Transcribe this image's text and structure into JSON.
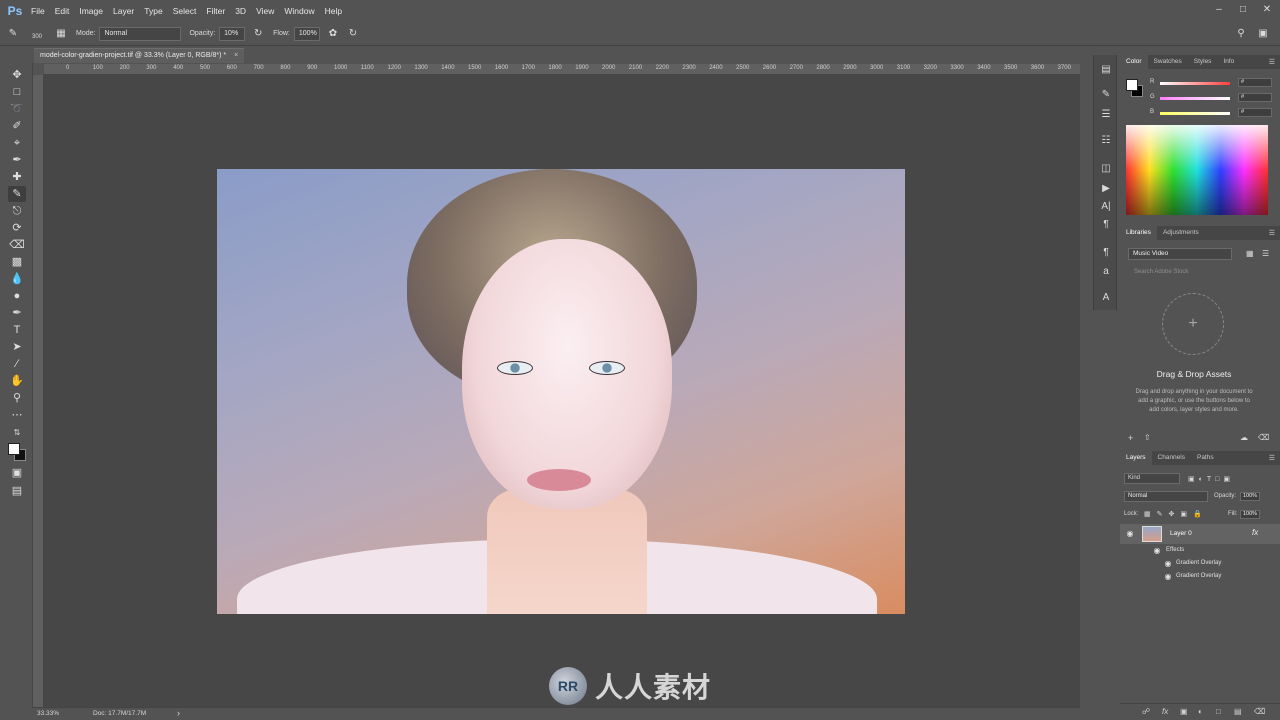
{
  "app": {
    "logo": "Ps"
  },
  "menu": [
    "File",
    "Edit",
    "Image",
    "Layer",
    "Type",
    "Select",
    "Filter",
    "3D",
    "View",
    "Window",
    "Help"
  ],
  "window_controls": {
    "minimize": "–",
    "maximize": "□",
    "close": "✕"
  },
  "options": {
    "brush_size": "300",
    "mode_label": "Mode:",
    "mode_value": "Normal",
    "opacity_label": "Opacity:",
    "opacity_value": "10%",
    "flow_label": "Flow:",
    "flow_value": "100%"
  },
  "document": {
    "tab_title": "model-color-gradien-project.tif @ 33.3% (Layer 0, RGB/8*) *",
    "close_label": "×"
  },
  "ruler_ticks": [
    "0",
    "100",
    "200",
    "300",
    "400",
    "500",
    "600",
    "700",
    "800",
    "900",
    "1000",
    "1100",
    "1200",
    "1300",
    "1400",
    "1500",
    "1600",
    "1700",
    "1800",
    "1900",
    "2000",
    "2100",
    "2200",
    "2300",
    "2400",
    "2500",
    "2600",
    "2700",
    "2800",
    "2900",
    "3000",
    "3100",
    "3200",
    "3300",
    "3400",
    "3500",
    "3600",
    "3700",
    "3800"
  ],
  "status": {
    "zoom": "33.33%",
    "doc": "Doc: 17.7M/17.7M",
    "arrow": "›"
  },
  "color_panel": {
    "tabs": [
      "Color",
      "Swatches",
      "Styles",
      "Info"
    ],
    "channels": [
      {
        "label": "R",
        "color": "#ff4040",
        "value": "#"
      },
      {
        "label": "G",
        "color": "#40ff40",
        "value": "#"
      },
      {
        "label": "B",
        "color": "#4080ff",
        "value": "#"
      }
    ]
  },
  "libraries_panel": {
    "tabs": [
      "Libraries",
      "Adjustments"
    ],
    "library": "Music Video",
    "search_placeholder": "Search Adobe Stock",
    "drop_title": "Drag & Drop Assets",
    "drop_desc": "Drag and drop anything in your document to add a graphic, or use the buttons below to add colors, layer styles and more."
  },
  "layers_panel": {
    "tabs": [
      "Layers",
      "Channels",
      "Paths"
    ],
    "filter": "Kind",
    "blend_mode": "Normal",
    "opacity_label": "Opacity:",
    "opacity_value": "100%",
    "lock_label": "Lock:",
    "fill_label": "Fill:",
    "fill_value": "100%",
    "layer_name": "Layer 0",
    "effects_label": "Effects",
    "effects": [
      "Gradient Overlay",
      "Gradient Overlay"
    ],
    "fx_label": "fx"
  },
  "watermark": {
    "logo": "RR",
    "text": "人人素材"
  }
}
